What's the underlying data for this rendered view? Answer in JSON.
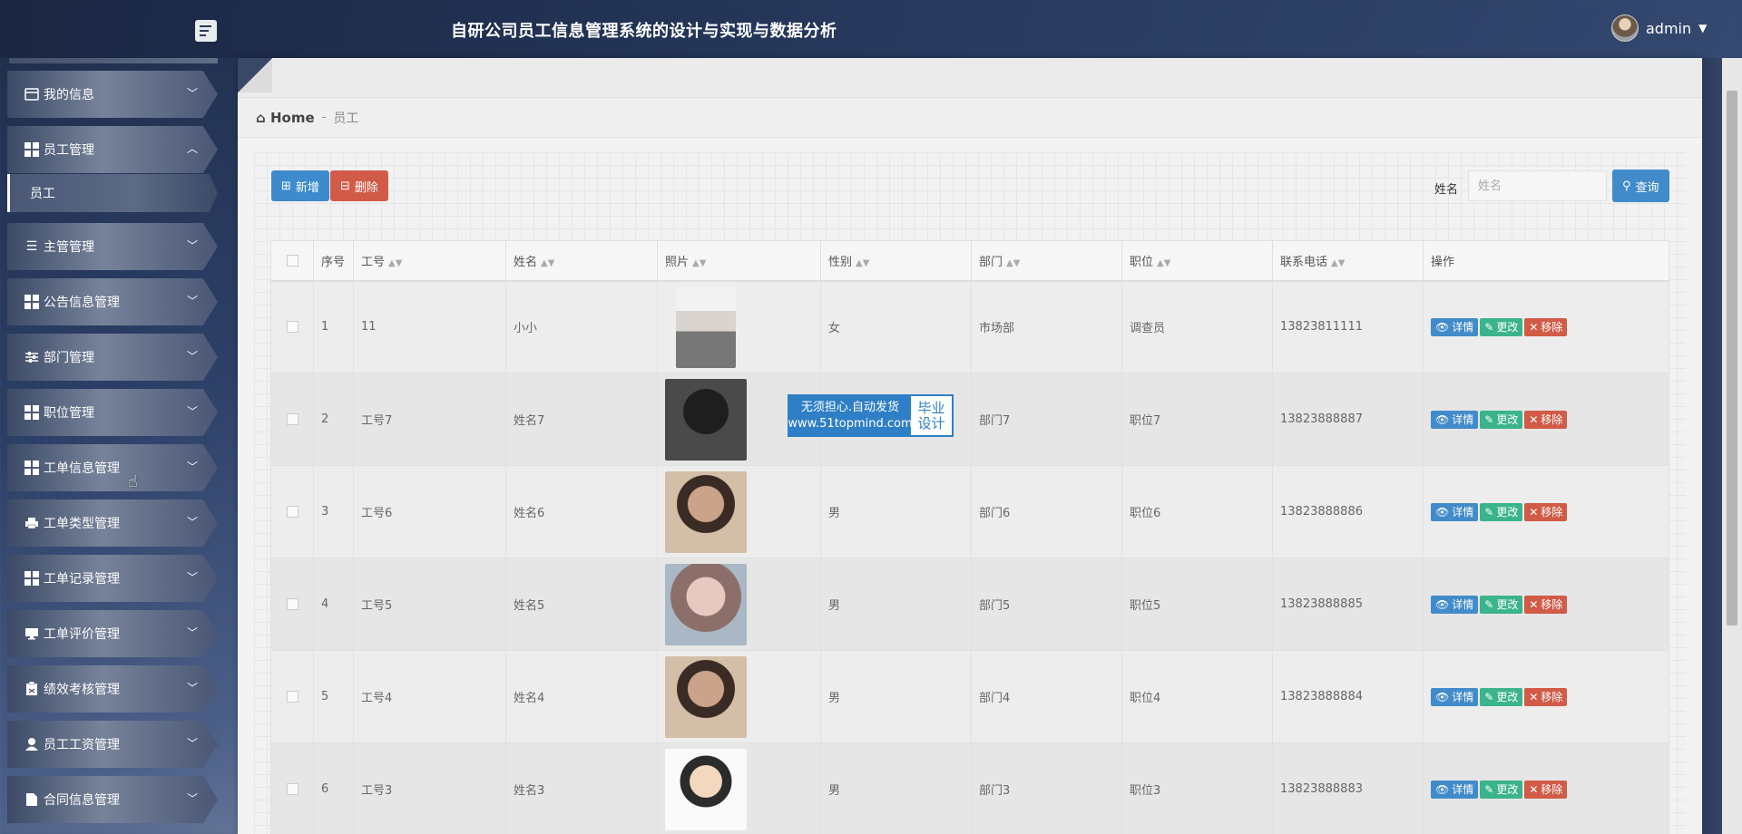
{
  "header": {
    "title": "自研公司员工信息管理系统的设计与实现与数据分析",
    "user": "admin"
  },
  "sidebar": {
    "items": [
      {
        "label": "我的信息",
        "icon": "card-icon"
      },
      {
        "label": "员工管理",
        "icon": "grid-icon",
        "expanded": true
      },
      {
        "label": "主管管理",
        "icon": "list-icon"
      },
      {
        "label": "公告信息管理",
        "icon": "grid-icon"
      },
      {
        "label": "部门管理",
        "icon": "sliders-icon"
      },
      {
        "label": "职位管理",
        "icon": "grid-icon"
      },
      {
        "label": "工单信息管理",
        "icon": "grid-icon"
      },
      {
        "label": "工单类型管理",
        "icon": "printer-icon"
      },
      {
        "label": "工单记录管理",
        "icon": "grid-icon"
      },
      {
        "label": "工单评价管理",
        "icon": "monitor-icon"
      },
      {
        "label": "绩效考核管理",
        "icon": "clipboard-icon"
      },
      {
        "label": "员工工资管理",
        "icon": "user-icon"
      },
      {
        "label": "合同信息管理",
        "icon": "file-icon"
      }
    ],
    "sub_item": "员工"
  },
  "breadcrumb": {
    "home": "Home",
    "separator": "-",
    "current": "员工"
  },
  "toolbar": {
    "add_label": "新增",
    "delete_label": "删除",
    "search_label": "姓名",
    "search_placeholder": "姓名",
    "query_label": "查询"
  },
  "table": {
    "headers": [
      "序号",
      "工号",
      "姓名",
      "照片",
      "性别",
      "部门",
      "职位",
      "联系电话",
      "操作"
    ],
    "rows": [
      {
        "index": "1",
        "emp_no": "11",
        "name": "小小",
        "gender": "女",
        "dept": "市场部",
        "position": "调查员",
        "phone": "13823811111"
      },
      {
        "index": "2",
        "emp_no": "工号7",
        "name": "姓名7",
        "gender": "",
        "dept": "部门7",
        "position": "职位7",
        "phone": "13823888887"
      },
      {
        "index": "3",
        "emp_no": "工号6",
        "name": "姓名6",
        "gender": "男",
        "dept": "部门6",
        "position": "职位6",
        "phone": "13823888886"
      },
      {
        "index": "4",
        "emp_no": "工号5",
        "name": "姓名5",
        "gender": "男",
        "dept": "部门5",
        "position": "职位5",
        "phone": "13823888885"
      },
      {
        "index": "5",
        "emp_no": "工号4",
        "name": "姓名4",
        "gender": "男",
        "dept": "部门4",
        "position": "职位4",
        "phone": "13823888884"
      },
      {
        "index": "6",
        "emp_no": "工号3",
        "name": "姓名3",
        "gender": "男",
        "dept": "部门3",
        "position": "职位3",
        "phone": "13823888883"
      }
    ],
    "actions": {
      "detail": "详情",
      "edit": "更改",
      "remove": "移除"
    }
  },
  "watermark": {
    "line1": "无须担心.自动发货",
    "line2": "www.51topmind.com",
    "right1": "毕业",
    "right2": "设计"
  },
  "colors": {
    "primary": "#428bca",
    "danger": "#d15b47",
    "success": "#3bb38c",
    "header_bg": "#26385c"
  }
}
